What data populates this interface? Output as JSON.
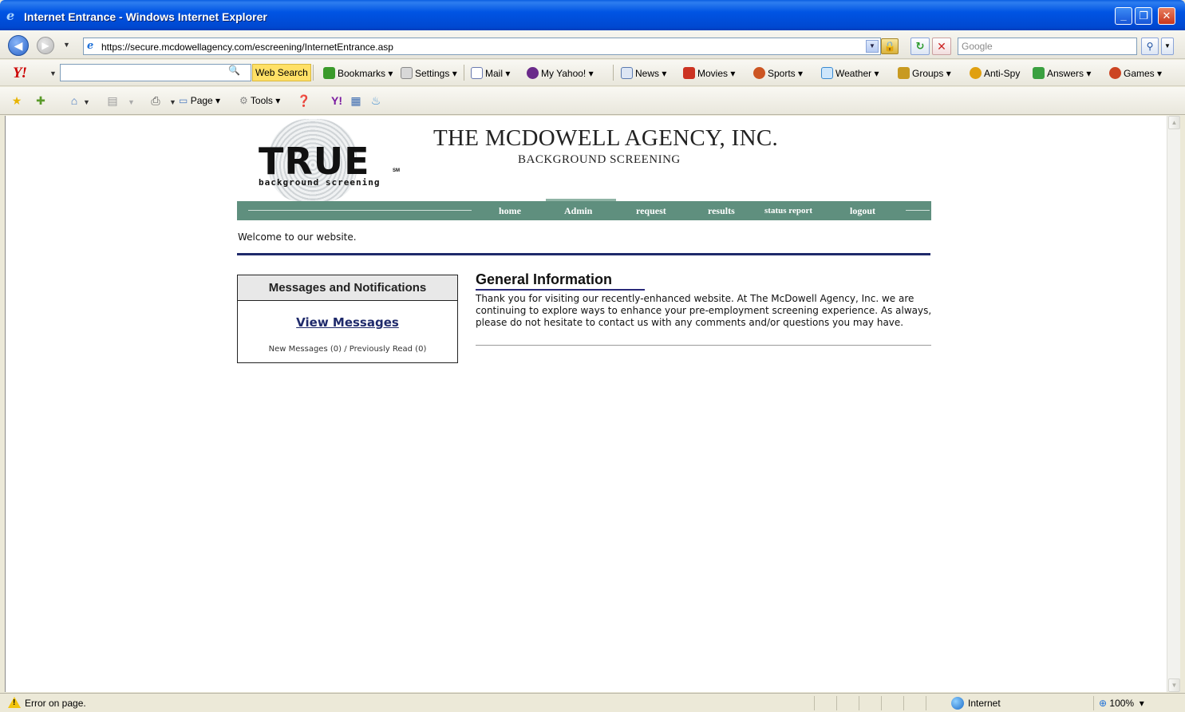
{
  "window": {
    "title": "Internet Entrance - Windows Internet Explorer",
    "buttons": {
      "minimize": "_",
      "restore": "❐",
      "close": "✕"
    }
  },
  "address_bar": {
    "url": "https://secure.mcdowellagency.com/escreening/InternetEntrance.asp",
    "search_placeholder": "Google"
  },
  "yahoo_toolbar": {
    "logo": "Y!",
    "search_button": "Web Search",
    "items": [
      {
        "label": "Bookmarks",
        "icon": "bookmarks-icon",
        "color": "#3a9a2a"
      },
      {
        "label": "Settings",
        "icon": "settings-icon",
        "color": "#9a9a9a"
      },
      {
        "label": "Mail",
        "icon": "mail-icon",
        "color": "#6a7ab0"
      },
      {
        "label": "My Yahoo!",
        "icon": "my-yahoo-icon",
        "color": "#6a2a8a"
      },
      {
        "label": "News",
        "icon": "news-icon",
        "color": "#5a7ab0"
      },
      {
        "label": "Movies",
        "icon": "movies-icon",
        "color": "#cc3322"
      },
      {
        "label": "Sports",
        "icon": "sports-icon",
        "color": "#cc5522"
      },
      {
        "label": "Weather",
        "icon": "weather-icon",
        "color": "#3a8ad0"
      },
      {
        "label": "Groups",
        "icon": "groups-icon",
        "color": "#c89a20"
      },
      {
        "label": "Anti-Spy",
        "icon": "anti-spy-icon",
        "color": "#e0a010"
      },
      {
        "label": "Answers",
        "icon": "answers-icon",
        "color": "#3aa040"
      },
      {
        "label": "Games",
        "icon": "games-icon",
        "color": "#cc4422"
      }
    ]
  },
  "command_bar": {
    "page": "Page",
    "tools": "Tools"
  },
  "site": {
    "logo_text": "TRUE",
    "logo_tm": "SM",
    "logo_sub": "background screening",
    "company": "THE MCDOWELL AGENCY, INC.",
    "company_sub": "BACKGROUND SCREENING",
    "nav": [
      {
        "label": "home"
      },
      {
        "label": "Admin"
      },
      {
        "label": "request"
      },
      {
        "label": "results"
      },
      {
        "label": "status report"
      },
      {
        "label": "logout"
      }
    ],
    "welcome": "Welcome to our website.",
    "messages": {
      "header": "Messages and Notifications",
      "link": "View Messages",
      "counts": "New Messages (0) / Previously Read (0)"
    },
    "general": {
      "title": "General Information",
      "body": "Thank you for visiting our recently-enhanced website. At The McDowell Agency, Inc. we are continuing to explore ways to enhance your pre-employment screening experience. As always, please do not hesitate to contact us with any comments and/or questions you may have."
    },
    "colors": {
      "nav_bg": "#5f8f7e",
      "rule": "#1f2a6b"
    }
  },
  "status_bar": {
    "message": "Error on page.",
    "zone": "Internet",
    "zoom": "100%"
  }
}
